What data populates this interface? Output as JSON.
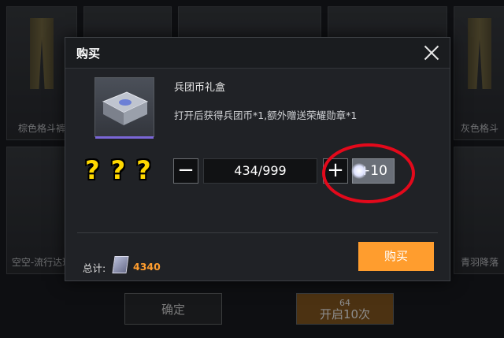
{
  "background": {
    "cards": [
      {
        "label": "棕色格斗裤"
      },
      {
        "label": "灰色格斗"
      },
      {
        "label": "空空-流行达球"
      },
      {
        "label": "青羽降落"
      }
    ],
    "confirm_button": "确定",
    "open_button": {
      "label": "开启10次",
      "cost": "64"
    }
  },
  "dialog": {
    "title": "购买",
    "item": {
      "name": "兵团币礼盒",
      "description": "打开后获得兵团币*1,额外赠送荣耀勋章*1"
    },
    "quantity": {
      "minus": "−",
      "value": "434/999",
      "plus": "+",
      "plus10": "+10"
    },
    "total": {
      "label": "总计:",
      "value": "4340"
    },
    "buy_button": "购买"
  },
  "annotation": {
    "question_marks": "???"
  },
  "colors": {
    "accent": "#ff9d2e",
    "highlight": "#e3091b",
    "question": "#ffd800"
  }
}
